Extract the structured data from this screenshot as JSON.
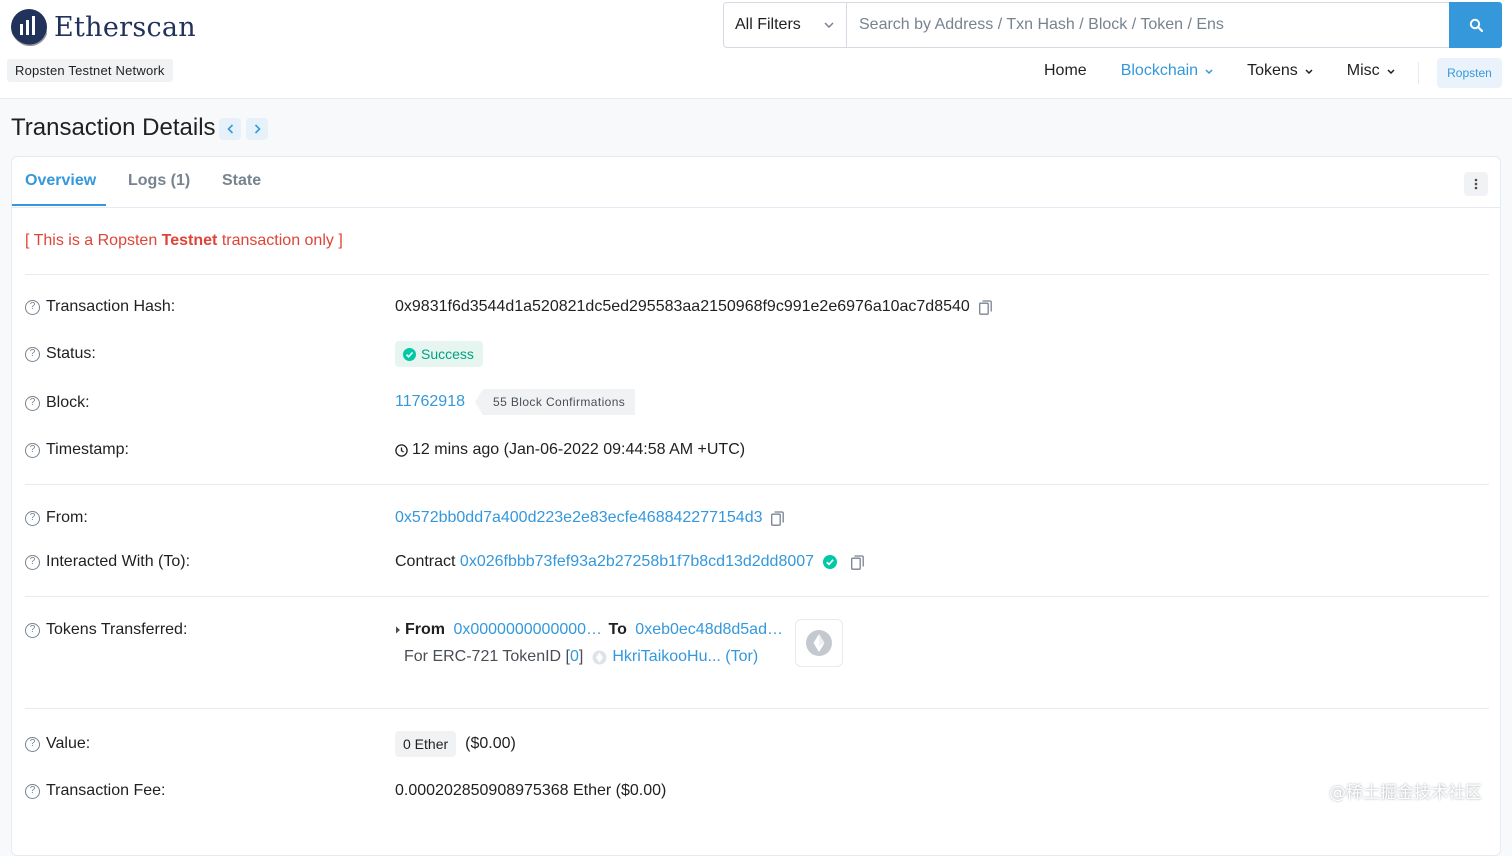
{
  "header": {
    "logo_text": "Etherscan",
    "network_badge": "Ropsten Testnet Network",
    "search": {
      "filter_label": "All Filters",
      "placeholder": "Search by Address / Txn Hash / Block / Token / Ens"
    },
    "nav": [
      {
        "label": "Home"
      },
      {
        "label": "Blockchain"
      },
      {
        "label": "Tokens"
      },
      {
        "label": "Misc"
      }
    ],
    "network_button": "Ropsten"
  },
  "page": {
    "title": "Transaction Details"
  },
  "tabs": [
    {
      "label": "Overview"
    },
    {
      "label": "Logs (1)"
    },
    {
      "label": "State"
    }
  ],
  "notice": {
    "prefix": "[ This is a Ropsten ",
    "bold": "Testnet",
    "suffix": " transaction only ]"
  },
  "details": {
    "tx_hash": {
      "label": "Transaction Hash:",
      "value": "0x9831f6d3544d1a520821dc5ed295583aa2150968f9c991e2e6976a10ac7d8540"
    },
    "status": {
      "label": "Status:",
      "value": "Success"
    },
    "block": {
      "label": "Block:",
      "value": "11762918",
      "confirmations": "55 Block Confirmations"
    },
    "timestamp": {
      "label": "Timestamp:",
      "value": "12 mins ago (Jan-06-2022 09:44:58 AM +UTC)"
    },
    "from": {
      "label": "From:",
      "value": "0x572bb0dd7a400d223e2e83ecfe468842277154d3"
    },
    "to": {
      "label": "Interacted With (To):",
      "prefix": "Contract",
      "value": "0x026fbbb73fef93a2b27258b1f7b8cd13d2dd8007"
    },
    "tokens": {
      "label": "Tokens Transferred:",
      "from_label": "From",
      "from_value": "0x0000000000000…",
      "to_label": "To",
      "to_value": "0xeb0ec48d8d5ad…",
      "for_label": "For ERC-721 TokenID [",
      "token_id": "0",
      "close_bracket": "]",
      "token_name": "HkriTaikooHu... (Tor)"
    },
    "value": {
      "label": "Value:",
      "amount": "0 Ether",
      "usd": "($0.00)"
    },
    "fee": {
      "label": "Transaction Fee:",
      "value": "0.000202850908975368 Ether ($0.00)"
    }
  },
  "watermark": "@稀土掘金技术社区"
}
